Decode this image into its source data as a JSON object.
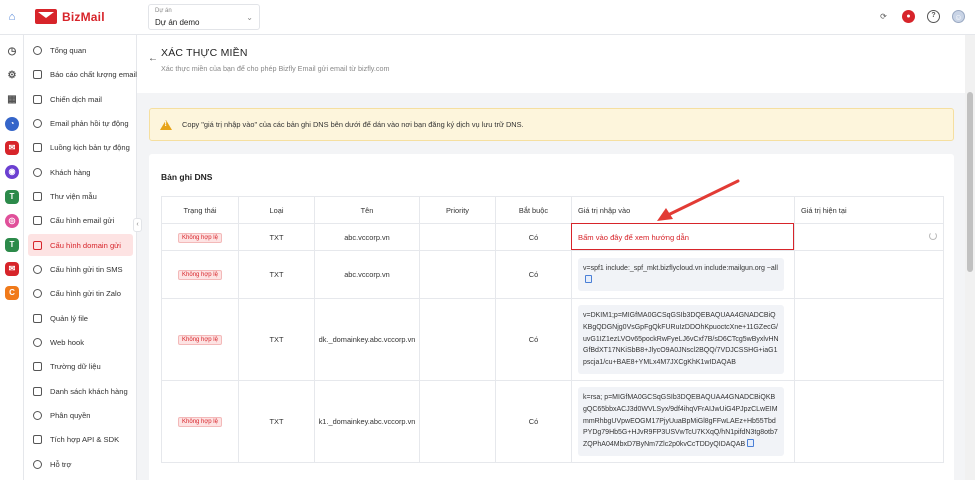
{
  "header": {
    "brand": "BizMail",
    "project_label": "Dự án",
    "project_value": "Dự án demo"
  },
  "sidebar": {
    "items": [
      {
        "label": "Tổng quan",
        "icon": "dashboard-icon"
      },
      {
        "label": "Báo cáo chất lượng email",
        "icon": "report-icon"
      },
      {
        "label": "Chiến dịch mail",
        "icon": "campaign-icon"
      },
      {
        "label": "Email phản hồi tự động",
        "icon": "autoreply-icon"
      },
      {
        "label": "Luồng kịch bản tự động",
        "icon": "workflow-icon"
      },
      {
        "label": "Khách hàng",
        "icon": "customers-icon"
      },
      {
        "label": "Thư viện mẫu",
        "icon": "template-icon"
      },
      {
        "label": "Cấu hình email gửi",
        "icon": "email-config-icon"
      },
      {
        "label": "Cấu hình domain gửi",
        "icon": "domain-config-icon"
      },
      {
        "label": "Cấu hình gửi tin SMS",
        "icon": "sms-config-icon"
      },
      {
        "label": "Cấu hình gửi tin Zalo",
        "icon": "zalo-config-icon"
      },
      {
        "label": "Quản lý file",
        "icon": "file-icon"
      },
      {
        "label": "Web hook",
        "icon": "webhook-icon"
      },
      {
        "label": "Trường dữ liệu",
        "icon": "data-field-icon"
      },
      {
        "label": "Danh sách khách hàng",
        "icon": "customer-list-icon"
      },
      {
        "label": "Phân quyền",
        "icon": "permission-icon"
      },
      {
        "label": "Tích hợp API & SDK",
        "icon": "api-icon"
      },
      {
        "label": "Hỗ trợ",
        "icon": "support-icon"
      }
    ],
    "active_index": 8
  },
  "page": {
    "title": "XÁC THỰC MIỀN",
    "subtitle": "Xác thực miền của bạn để cho phép Bizfly Email gửi email từ bizfly.com",
    "alert": "Copy \"giá trị nhập vào\" của các bản ghi DNS bên dưới để dán vào nơi bạn đăng ký dịch vụ lưu trữ DNS."
  },
  "dns": {
    "section_title": "Bản ghi DNS",
    "columns": [
      "Trạng thái",
      "Loại",
      "Tên",
      "Priority",
      "Bắt buộc",
      "Giá trị nhập vào",
      "Giá trị hiện tại"
    ],
    "guide_link": "Bấm vào đây để xem hướng dẫn",
    "rows": [
      {
        "status": "Không hợp lệ",
        "type": "TXT",
        "name": "abc.vccorp.vn",
        "priority": "",
        "required": "Có",
        "value": "",
        "current": ""
      },
      {
        "status": "Không hợp lệ",
        "type": "TXT",
        "name": "abc.vccorp.vn",
        "priority": "",
        "required": "Có",
        "value": "v=spf1  include:_spf_mkt.bizflycloud.vn  include:mailgun.org ~all",
        "current": ""
      },
      {
        "status": "Không hợp lệ",
        "type": "TXT",
        "name": "dk._domainkey.abc.vccorp.vn",
        "priority": "",
        "required": "Có",
        "value": "v=DKIM1;p=MIGfMA0GCSqGSIb3DQEBAQUAA4GNADCBiQKBgQDGNjg0VsGpFgQkFURuIzDDOhKpuoctcXne+11GZecG/uvG1IZ1ezLVOv65pockRwFyeLJ6vCxf7B/sD6CTcg5wByxlvHNGfBdXT17NKiSbB8+JlycO9A0JNscl2BQQ/7VDJCSSHG+iaG1pscja1/cu+BAE8+YMLx4M7JXCgKhK1wIDAQAB",
        "current": ""
      },
      {
        "status": "Không hợp lệ",
        "type": "TXT",
        "name": "k1._domainkey.abc.vccorp.vn",
        "priority": "",
        "required": "Có",
        "value": "k=rsa;  p=MIGfMA0GCSqGSIb3DQEBAQUAA4GNADCBiQKBgQC65bbxACJ3d0WVLSyx/9df4ihqVFrAIJwUiG4PJpzCLwEIMmmRhbgUVpwEOGM17PjyUuaBpMiGl8gFFwLAEz+Hb55TbdPYDg79Hb5G+HJvR9FP3USVwTcU7KXqQ/hN1pifdN3tg8otb7ZQPhA04MbxD7ByNm7Zlc2p0kvCcTDDyQIDAQAB",
        "current": ""
      }
    ]
  },
  "colors": {
    "brand_red": "#d7242a",
    "alert_bg": "#fdf5dc",
    "badge_bg": "#fde3e3"
  }
}
